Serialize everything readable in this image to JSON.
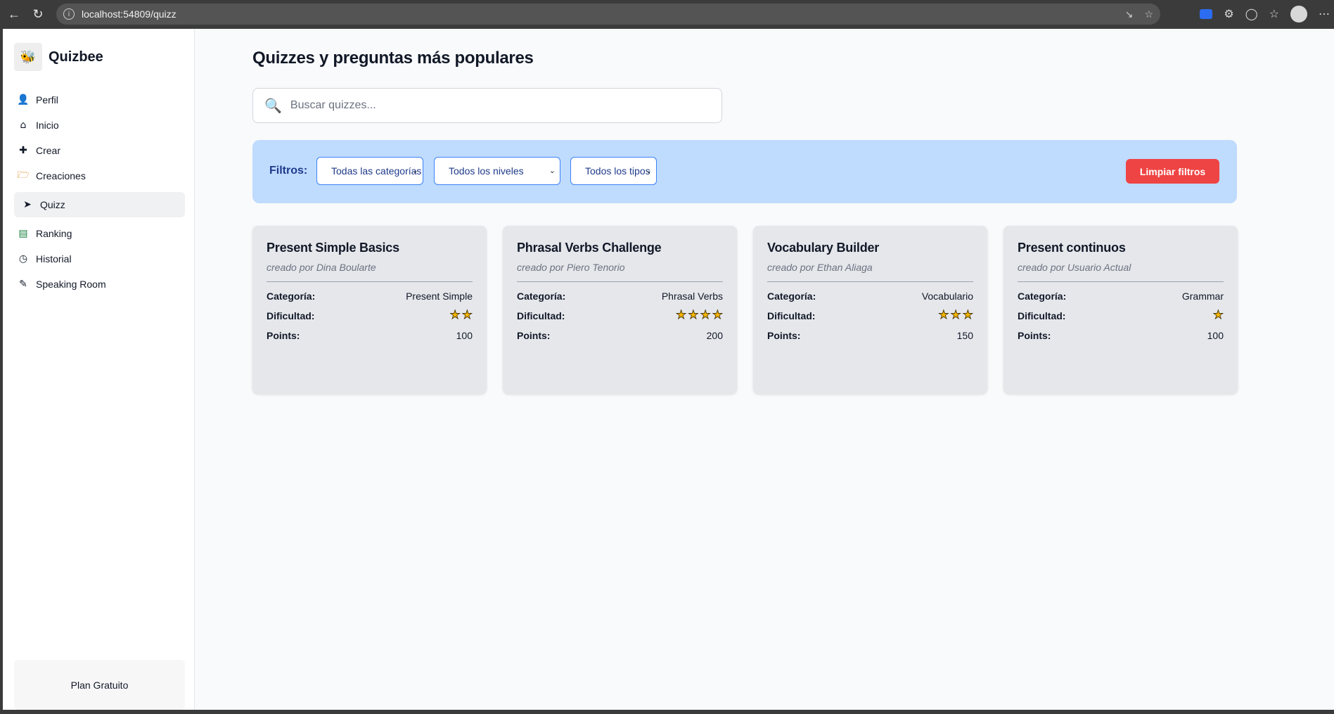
{
  "browser": {
    "url": "localhost:54809/quizz",
    "back_icon": "arrow-left-icon",
    "reload_icon": "reload-icon"
  },
  "sidebar": {
    "brand": "Quizbee",
    "items": [
      {
        "label": "Perfil",
        "icon": "user-icon"
      },
      {
        "label": "Inicio",
        "icon": "home-icon"
      },
      {
        "label": "Crear",
        "icon": "plus-icon"
      },
      {
        "label": "Creaciones",
        "icon": "folder-icon"
      },
      {
        "label": "Quizz",
        "icon": "rocket-icon",
        "active": true
      },
      {
        "label": "Ranking",
        "icon": "bar-chart-icon"
      },
      {
        "label": "Historial",
        "icon": "clock-icon"
      },
      {
        "label": "Speaking Room",
        "icon": "pen-icon"
      }
    ],
    "plan": "Plan Gratuito"
  },
  "main": {
    "title": "Quizzes y preguntas más populares",
    "search": {
      "placeholder": "Buscar quizzes..."
    },
    "filters": {
      "label": "Filtros:",
      "category": "Todas las categorías",
      "level": "Todos los niveles",
      "type": "Todos los tipos",
      "clear": "Limpiar filtros"
    },
    "card_labels": {
      "category": "Categoría:",
      "difficulty": "Dificultad:",
      "points": "Points:"
    },
    "cards": [
      {
        "title": "Present Simple Basics",
        "author": "creado por Dina Boularte",
        "category": "Present Simple",
        "difficulty": 2,
        "points": "100"
      },
      {
        "title": "Phrasal Verbs Challenge",
        "author": "creado por Piero Tenorio",
        "category": "Phrasal Verbs",
        "difficulty": 4,
        "points": "200"
      },
      {
        "title": "Vocabulary Builder",
        "author": "creado por Ethan Aliaga",
        "category": "Vocabulario",
        "difficulty": 3,
        "points": "150"
      },
      {
        "title": "Present continuos",
        "author": "creado por Usuario Actual",
        "category": "Grammar",
        "difficulty": 1,
        "points": "100"
      }
    ]
  },
  "colors": {
    "accent": "#bfdbfe",
    "danger": "#ef4444",
    "star": "#f5b400"
  }
}
